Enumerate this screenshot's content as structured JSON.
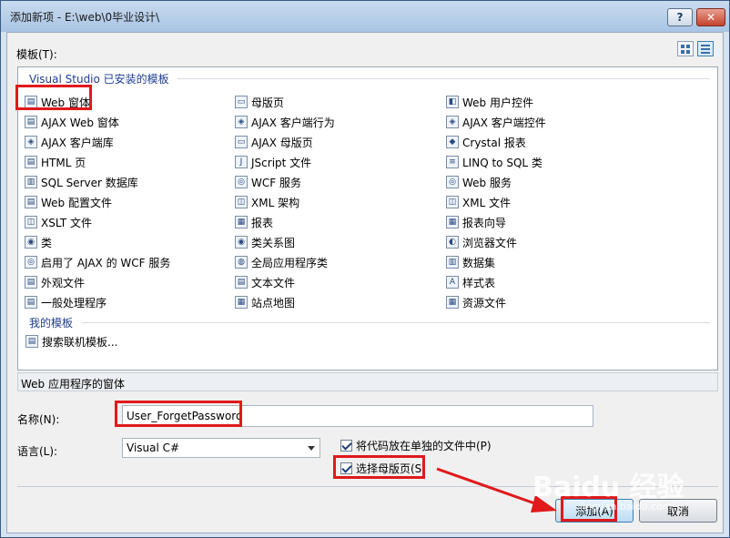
{
  "window": {
    "title": "添加新项 - E:\\web\\0毕业设计\\",
    "help_label": "?",
    "close_label": "✕"
  },
  "templates": {
    "label": "模板(T):",
    "group_installed": "Visual Studio 已安装的模板",
    "group_mine": "我的模板",
    "items": [
      {
        "label": "Web 窗体",
        "icon": "web-form-icon",
        "glyph": "▤"
      },
      {
        "label": "母版页",
        "icon": "master-page-icon",
        "glyph": "▭"
      },
      {
        "label": "Web 用户控件",
        "icon": "user-control-icon",
        "glyph": "◧"
      },
      {
        "label": "AJAX Web 窗体",
        "icon": "ajax-form-icon",
        "glyph": "▤"
      },
      {
        "label": "AJAX 客户端行为",
        "icon": "ajax-behavior-icon",
        "glyph": "◈"
      },
      {
        "label": "AJAX 客户端控件",
        "icon": "ajax-control-icon",
        "glyph": "◈"
      },
      {
        "label": "AJAX 客户端库",
        "icon": "ajax-library-icon",
        "glyph": "◈"
      },
      {
        "label": "AJAX 母版页",
        "icon": "ajax-master-icon",
        "glyph": "▭"
      },
      {
        "label": "Crystal 报表",
        "icon": "crystal-report-icon",
        "glyph": "◆"
      },
      {
        "label": "HTML 页",
        "icon": "html-page-icon",
        "glyph": "▤"
      },
      {
        "label": "JScript 文件",
        "icon": "jscript-icon",
        "glyph": "J"
      },
      {
        "label": "LINQ to SQL 类",
        "icon": "linq-icon",
        "glyph": "≡"
      },
      {
        "label": "SQL Server 数据库",
        "icon": "database-icon",
        "glyph": "▥"
      },
      {
        "label": "WCF 服务",
        "icon": "wcf-service-icon",
        "glyph": "◎"
      },
      {
        "label": "Web 服务",
        "icon": "web-service-icon",
        "glyph": "◎"
      },
      {
        "label": "Web 配置文件",
        "icon": "config-icon",
        "glyph": "▤"
      },
      {
        "label": "XML 架构",
        "icon": "xml-schema-icon",
        "glyph": "◫"
      },
      {
        "label": "XML 文件",
        "icon": "xml-file-icon",
        "glyph": "◫"
      },
      {
        "label": "XSLT 文件",
        "icon": "xslt-icon",
        "glyph": "◫"
      },
      {
        "label": "报表",
        "icon": "report-icon",
        "glyph": "▦"
      },
      {
        "label": "报表向导",
        "icon": "report-wizard-icon",
        "glyph": "▦"
      },
      {
        "label": "类",
        "icon": "class-icon",
        "glyph": "◉"
      },
      {
        "label": "类关系图",
        "icon": "class-diagram-icon",
        "glyph": "◉"
      },
      {
        "label": "浏览器文件",
        "icon": "browser-file-icon",
        "glyph": "◐"
      },
      {
        "label": "启用了 AJAX 的 WCF 服务",
        "icon": "ajax-wcf-icon",
        "glyph": "◎"
      },
      {
        "label": "全局应用程序类",
        "icon": "global-class-icon",
        "glyph": "◍"
      },
      {
        "label": "数据集",
        "icon": "dataset-icon",
        "glyph": "▥"
      },
      {
        "label": "外观文件",
        "icon": "skin-file-icon",
        "glyph": "▤"
      },
      {
        "label": "文本文件",
        "icon": "text-file-icon",
        "glyph": "▤"
      },
      {
        "label": "样式表",
        "icon": "stylesheet-icon",
        "glyph": "A"
      },
      {
        "label": "一般处理程序",
        "icon": "handler-icon",
        "glyph": "▤"
      },
      {
        "label": "站点地图",
        "icon": "sitemap-icon",
        "glyph": "▦"
      },
      {
        "label": "资源文件",
        "icon": "resource-file-icon",
        "glyph": "▦"
      }
    ],
    "search_online": "搜索联机模板...",
    "search_glyph": "▤"
  },
  "description": "Web 应用程序的窗体",
  "form": {
    "name_label": "名称(N):",
    "name_value": "User_ForgetPassword",
    "language_label": "语言(L):",
    "language_value": "Visual C#",
    "separate_code_label": "将代码放在单独的文件中(P)",
    "select_master_label": "选择母版页(S)"
  },
  "buttons": {
    "add": "添加(A)",
    "cancel": "取消"
  },
  "watermark": {
    "main": "Baidu 经验",
    "sub": "jingyan.baidu.com"
  },
  "colors": {
    "highlight": "#e0191b",
    "group_heading": "#1e3d8f"
  }
}
